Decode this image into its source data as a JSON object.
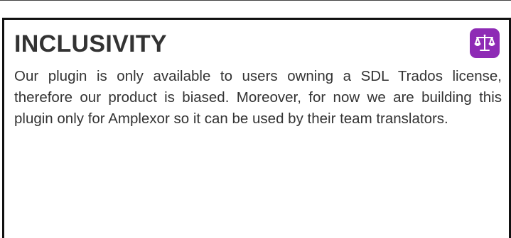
{
  "section": {
    "title": "INCLUSIVITY",
    "icon": "scale-icon",
    "icon_bg_color": "#8e2bb5",
    "body": "Our plugin is only available to users owning a SDL Trados license, therefore our product is biased. Moreover, for now we are building this plugin only for Amplexor so it can be used by their team translators."
  }
}
